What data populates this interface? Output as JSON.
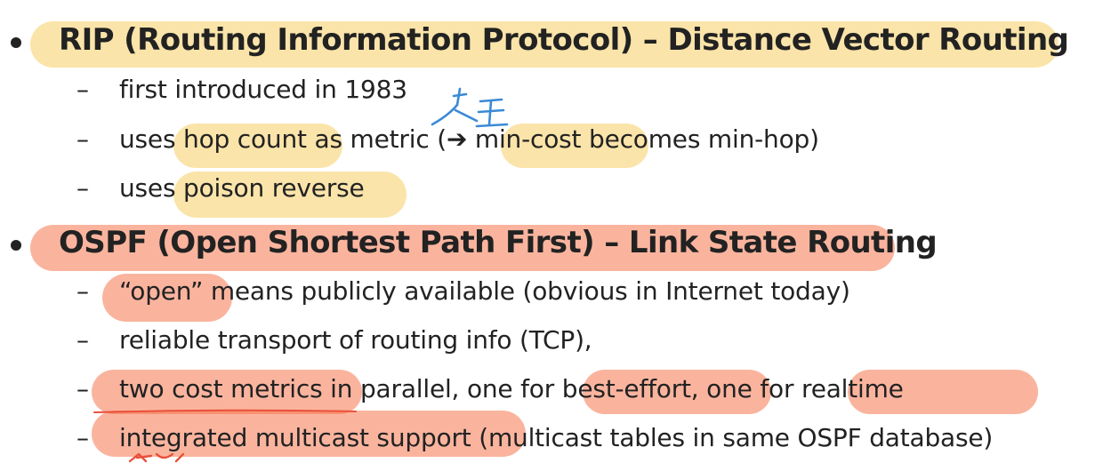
{
  "sections": [
    {
      "heading": "RIP (Routing Information Protocol) – Distance Vector Routing",
      "points": [
        {
          "text": "first introduced in 1983"
        },
        {
          "pre": "uses hop count as metric (",
          "arrow": "➔",
          "post": " min-cost becomes min-hop)"
        },
        {
          "text": "uses poison reverse"
        }
      ]
    },
    {
      "heading": "OSPF (Open Shortest Path First) – Link State Routing",
      "points": [
        {
          "text": "“open” means publicly available (obvious in Internet today)"
        },
        {
          "text": "reliable transport of routing info (TCP),"
        },
        {
          "text": "two cost metrics in parallel, one for best-effort, one for realtime"
        },
        {
          "text": "integrated multicast support (multicast tables in same OSPF database)"
        }
      ]
    }
  ],
  "dash_symbol": "–",
  "colors": {
    "text": "#222222",
    "highlight_yellow": "#f6cd63",
    "highlight_orange": "#f5764e",
    "ink_blue": "#3a8ad6",
    "ink_red": "#e9503a"
  }
}
